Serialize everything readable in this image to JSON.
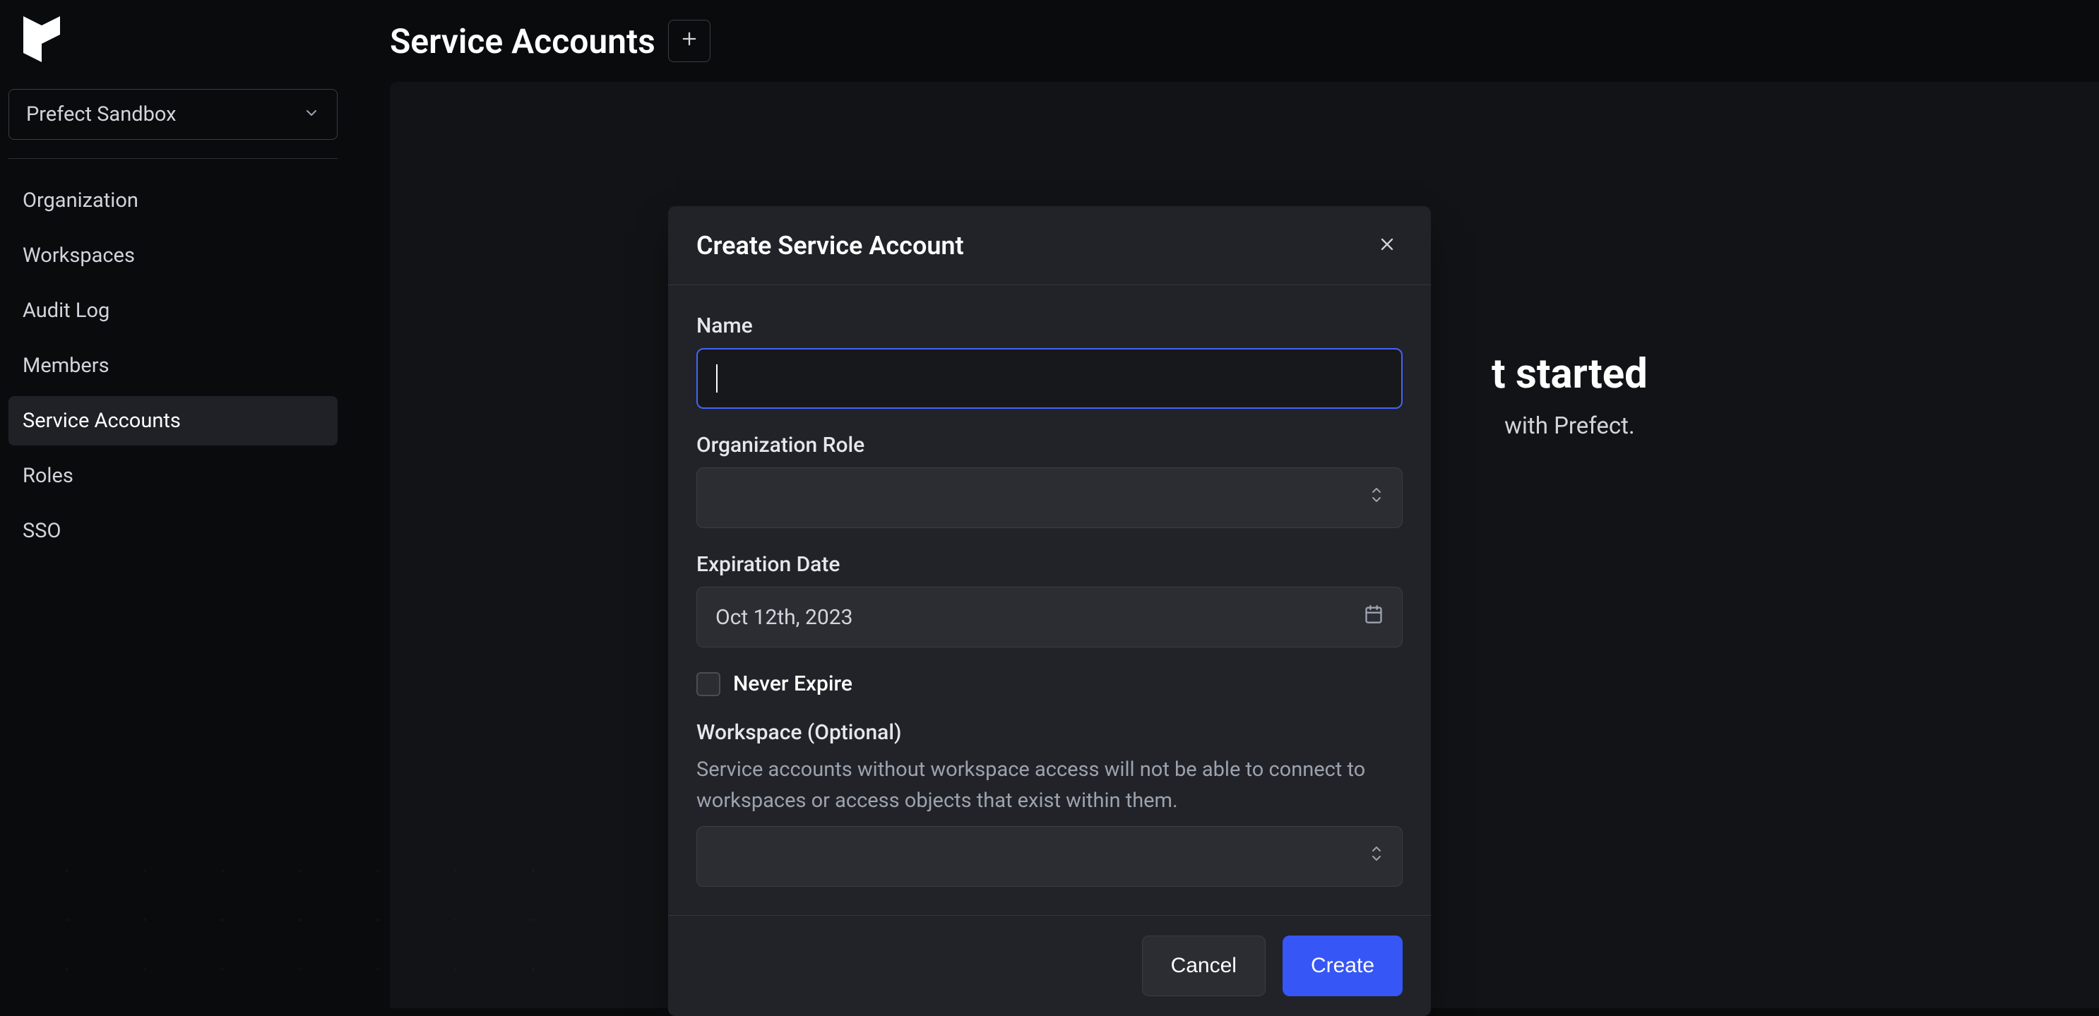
{
  "sidebar": {
    "workspace_label": "Prefect Sandbox",
    "items": [
      {
        "label": "Organization",
        "active": false
      },
      {
        "label": "Workspaces",
        "active": false
      },
      {
        "label": "Audit Log",
        "active": false
      },
      {
        "label": "Members",
        "active": false
      },
      {
        "label": "Service Accounts",
        "active": true
      },
      {
        "label": "Roles",
        "active": false
      },
      {
        "label": "SSO",
        "active": false
      }
    ]
  },
  "header": {
    "page_title": "Service Accounts"
  },
  "background": {
    "heading_suffix": "t started",
    "subtitle_suffix": "with Prefect."
  },
  "modal": {
    "title": "Create Service Account",
    "name_label": "Name",
    "name_value": "",
    "org_role_label": "Organization Role",
    "org_role_value": "",
    "expiration_label": "Expiration Date",
    "expiration_value": "Oct 12th, 2023",
    "never_expire_label": "Never Expire",
    "never_expire_checked": false,
    "workspace_label": "Workspace (Optional)",
    "workspace_help": "Service accounts without workspace access will not be able to connect to workspaces or access objects that exist within them.",
    "workspace_value": "",
    "cancel_label": "Cancel",
    "create_label": "Create"
  },
  "colors": {
    "accent": "#3656f5",
    "focus": "#4364f7",
    "bg": "#0a0b0d",
    "panel": "#212328"
  }
}
